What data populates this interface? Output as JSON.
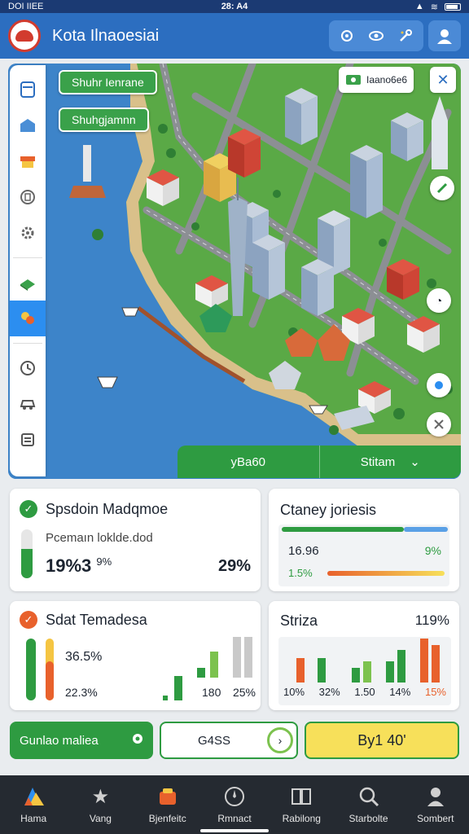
{
  "status_bar": {
    "left": "DOI IIEE",
    "time": "28: A4"
  },
  "app_bar": {
    "title": "Kota Ilnaoesiai"
  },
  "map": {
    "chip_top": "Shuhr Ienrane",
    "chip_second": "Shuhgjamnn",
    "legend_label": "Iaano6e6",
    "bottom_left": "yBa60",
    "bottom_right": "Stitam"
  },
  "cards": {
    "station": {
      "title": "Spsdoin Madqmoe",
      "subtitle": "Pcemaın loklde.dod",
      "value_left": "19%3",
      "value_left_suffix": "9%",
      "value_right": "29%"
    },
    "chart_top": {
      "title": "Ctaney joriesis",
      "row1_left": "16.96",
      "row1_right": "9%",
      "row2_left": "1.5%"
    },
    "temp": {
      "title": "Sdat Temadesa",
      "value_a": "36.5%",
      "value_b": "22.3%",
      "label_x1": "180",
      "label_x2": "25%"
    },
    "stats": {
      "title": "Striza",
      "headline": "119%",
      "labels": [
        "10%",
        "32%",
        "1.50",
        "14%",
        "15%"
      ]
    }
  },
  "bottom_actions": {
    "left_label": "Gunlao maliea",
    "middle_label": "G4SS",
    "right_label": "By1 40'"
  },
  "nav": {
    "items": [
      {
        "label": "Hama",
        "icon": "home-icon"
      },
      {
        "label": "Vang",
        "icon": "star-icon"
      },
      {
        "label": "Bjenfeitc",
        "icon": "shop-icon"
      },
      {
        "label": "Rmnact",
        "icon": "compass-icon"
      },
      {
        "label": "Rabilong",
        "icon": "book-icon"
      },
      {
        "label": "Starbolte",
        "icon": "search-icon"
      },
      {
        "label": "Sombert",
        "icon": "profile-icon"
      }
    ]
  },
  "colors": {
    "primary": "#2c6ec0",
    "green": "#2e9b41",
    "orange": "#e8612c",
    "yellow": "#f7e05a"
  }
}
